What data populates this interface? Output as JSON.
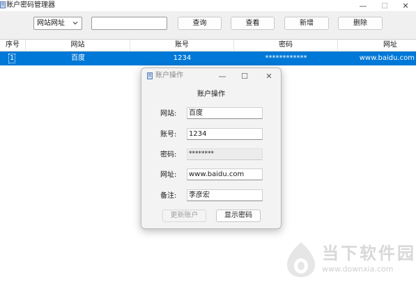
{
  "window": {
    "title": "账户密码管理器",
    "controls": {
      "minimize": "—",
      "maximize": "☐",
      "close": "✕"
    }
  },
  "toolbar": {
    "filter_value": "网站网址",
    "search_value": "",
    "buttons": {
      "query": "查询",
      "view": "查看",
      "add": "新增",
      "delete": "删除"
    }
  },
  "table": {
    "columns": [
      "序号",
      "网站",
      "账号",
      "密码",
      "网址"
    ],
    "rows": [
      {
        "index": "1",
        "site": "百度",
        "account": "1234",
        "password": "************",
        "url": "www.baidu.com",
        "selected": true
      }
    ]
  },
  "dialog": {
    "title": "账户操作",
    "heading": "账户操作",
    "controls": {
      "minimize": "—",
      "maximize": "☐",
      "close": "✕"
    },
    "fields": {
      "site": {
        "label": "网站:",
        "value": "百度"
      },
      "account": {
        "label": "账号:",
        "value": "1234"
      },
      "password": {
        "label": "密码:",
        "value": "********"
      },
      "url": {
        "label": "网址:",
        "value": "www.baidu.com"
      },
      "note": {
        "label": "备注:",
        "value": "李彦宏"
      }
    },
    "buttons": {
      "update": "更新账户",
      "show_password": "显示密码"
    }
  },
  "watermark": {
    "text": "当下软件园",
    "url": "www.downxia.com"
  },
  "colors": {
    "selection": "#0078d7",
    "toolbar_bg": "#f0f0f0",
    "dialog_bg": "#f3f3f3",
    "watermark": "#d8d8d8"
  }
}
